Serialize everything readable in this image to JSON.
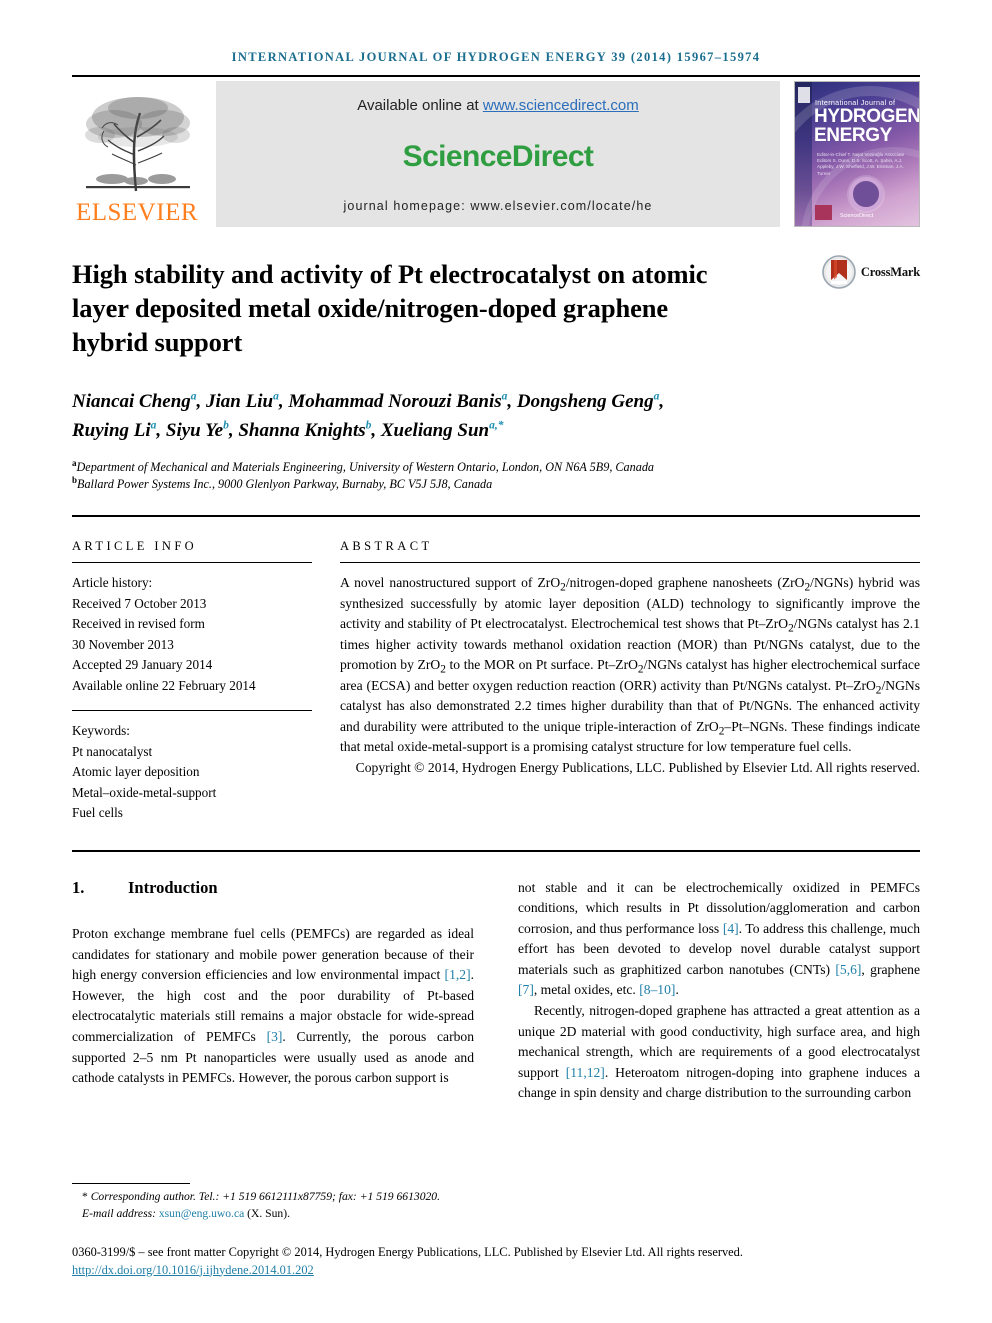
{
  "running_head": "International Journal of Hydrogen Energy 39 (2014) 15967–15974",
  "masthead": {
    "publisher_logo_text": "ELSEVIER",
    "available_prefix": "Available online at ",
    "available_url": "www.sciencedirect.com",
    "sciencedirect_logo": "ScienceDirect",
    "journal_homepage": "journal homepage: www.elsevier.com/locate/he",
    "cover": {
      "title_small": "International Journal of",
      "title_line1": "HYDROGEN",
      "title_line2": "ENERGY",
      "editors_text": "Editor-in-Chief  T. Nejat Veziroğlu\nAssociate Editors  S. Dunn, D.S. Scott, A. Şahin, A.J. Appleby, J.W. Sheffield, J.W. Erisman, J.A. Turner",
      "sciencedirect_mark": "ScienceDirect"
    }
  },
  "article": {
    "title": "High stability and activity of Pt electrocatalyst on atomic layer deposited metal oxide/nitrogen-doped graphene hybrid support",
    "crossmark_label": "CrossMark",
    "authors_html": "Niancai Cheng<sup>a</sup>, Jian Liu<sup>a</sup>, Mohammad Norouzi Banis<sup>a</sup>, Dongsheng Geng<sup>a</sup>, Ruying Li<sup>a</sup>, Siyu Ye<sup>b</sup>, Shanna Knights<sup>b</sup>, Xueliang Sun<sup>a,*</sup>",
    "affiliations": [
      {
        "marker": "a",
        "text": "Department of Mechanical and Materials Engineering, University of Western Ontario, London, ON N6A 5B9, Canada"
      },
      {
        "marker": "b",
        "text": "Ballard Power Systems Inc., 9000 Glenlyon Parkway, Burnaby, BC V5J 5J8, Canada"
      }
    ]
  },
  "article_info": {
    "heading": "Article info",
    "history_label": "Article history:",
    "history": [
      "Received 7 October 2013",
      "Received in revised form",
      "30 November 2013",
      "Accepted 29 January 2014",
      "Available online 22 February 2014"
    ],
    "keywords_label": "Keywords:",
    "keywords": [
      "Pt nanocatalyst",
      "Atomic layer deposition",
      "Metal–oxide-metal-support",
      "Fuel cells"
    ]
  },
  "abstract": {
    "heading": "Abstract",
    "body_html": "A novel nanostructured support of ZrO<sub>2</sub>/nitrogen-doped graphene nanosheets (ZrO<sub>2</sub>/NGNs) hybrid was synthesized successfully by atomic layer deposition (ALD) technology to significantly improve the activity and stability of Pt electrocatalyst. Electrochemical test shows that Pt–ZrO<sub>2</sub>/NGNs catalyst has 2.1 times higher activity towards methanol oxidation reaction (MOR) than Pt/NGNs catalyst, due to the promotion by ZrO<sub>2</sub> to the MOR on Pt surface. Pt–ZrO<sub>2</sub>/NGNs catalyst has higher electrochemical surface area (ECSA) and better oxygen reduction reaction (ORR) activity than Pt/NGNs catalyst. Pt–ZrO<sub>2</sub>/NGNs catalyst has also demonstrated 2.2 times higher durability than that of Pt/NGNs. The enhanced activity and durability were attributed to the unique triple-interaction of ZrO<sub>2</sub>–Pt–NGNs. These findings indicate that metal oxide-metal-support is a promising catalyst structure for low temperature fuel cells.",
    "copyright": "Copyright © 2014, Hydrogen Energy Publications, LLC. Published by Elsevier Ltd. All rights reserved."
  },
  "introduction": {
    "number": "1.",
    "title": "Introduction",
    "left_paragraph_html": "Proton exchange membrane fuel cells (PEMFCs) are regarded as ideal candidates for stationary and mobile power generation because of their high energy conversion efficiencies and low environmental impact <span class=\"ref\">[1,2]</span>. However, the high cost and the poor durability of Pt-based electrocatalytic materials still remains a major obstacle for wide-spread commercialization of PEMFCs <span class=\"ref\">[3]</span>. Currently, the porous carbon supported 2–5 nm Pt nanoparticles were usually used as anode and cathode catalysts in PEMFCs. However, the porous carbon support is",
    "right_paragraph1_html": "not stable and it can be electrochemically oxidized in PEMFCs conditions, which results in Pt dissolution/agglomeration and carbon corrosion, and thus performance loss <span class=\"ref\">[4]</span>. To address this challenge, much effort has been devoted to develop novel durable catalyst support materials such as graphitized carbon nanotubes (CNTs) <span class=\"ref\">[5,6]</span>, graphene <span class=\"ref\">[7]</span>, metal oxides, etc. <span class=\"ref\">[8–10]</span>.",
    "right_paragraph2_html": "Recently, nitrogen-doped graphene has attracted a great attention as a unique 2D material with good conductivity, high surface area, and high mechanical strength, which are requirements of a good electrocatalyst support <span class=\"ref\">[11,12]</span>. Heteroatom nitrogen-doping into graphene induces a change in spin density and charge distribution to the surrounding carbon"
  },
  "footnote": {
    "corresponding_html": "<span class=\"star\">*</span> Corresponding author. Tel.: +1 519 6612111x87759; fax: +1 519 6613020.",
    "email_label": "E-mail address:",
    "email": "xsun@eng.uwo.ca",
    "email_suffix": "(X. Sun)."
  },
  "footer": {
    "frontmatter": "0360-3199/$ – see front matter Copyright © 2014, Hydrogen Energy Publications, LLC. Published by Elsevier Ltd. All rights reserved.",
    "doi": "http://dx.doi.org/10.1016/j.ijhydene.2014.01.202"
  },
  "colors": {
    "running_head": "#1a6d8f",
    "link": "#1f7fa8",
    "elsevier_orange": "#ff7f1e",
    "sciencedirect_green": "#2f9e41",
    "banner_bg": "#e4e4e4"
  }
}
